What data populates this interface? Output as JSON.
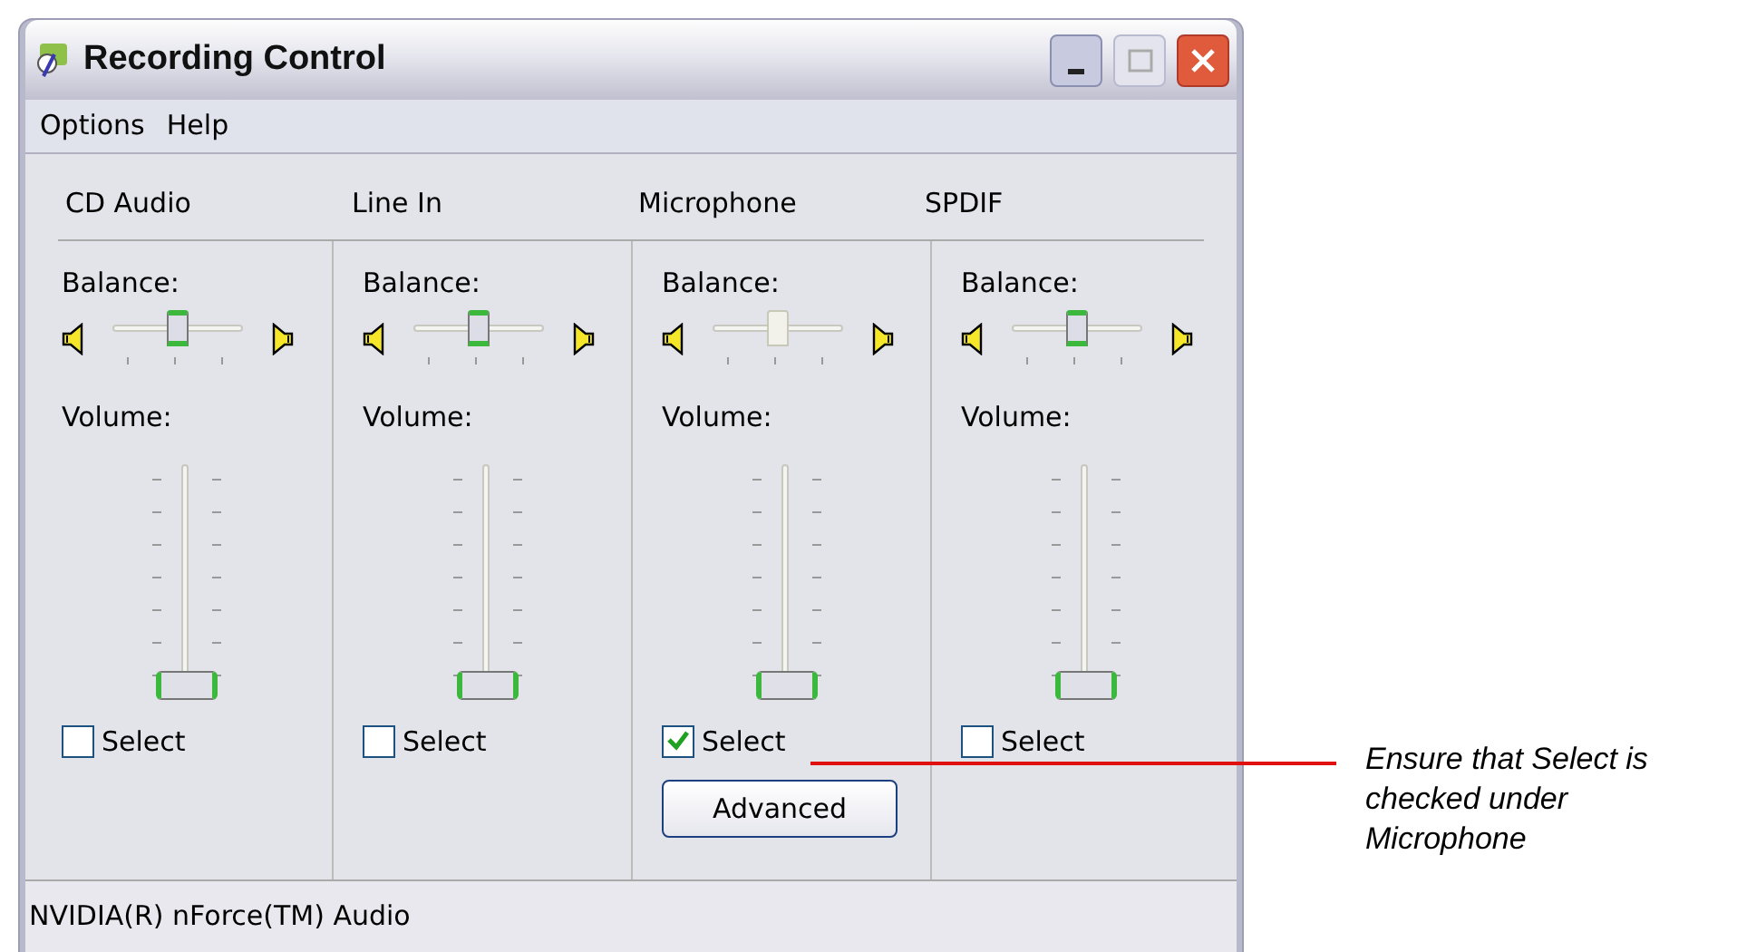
{
  "window": {
    "title": "Recording Control"
  },
  "menu": [
    "Options",
    "Help"
  ],
  "channels": [
    {
      "name": "CD Audio",
      "balance_label": "Balance:",
      "balance": {
        "level": 0.5,
        "focused": false
      },
      "volume_label": "Volume:",
      "volume": {
        "level": 0
      },
      "select": {
        "label": "Select",
        "checked": false
      }
    },
    {
      "name": "Line In",
      "balance_label": "Balance:",
      "balance": {
        "level": 0.5,
        "focused": false
      },
      "volume_label": "Volume:",
      "volume": {
        "level": 0
      },
      "select": {
        "label": "Select",
        "checked": false
      }
    },
    {
      "name": "Microphone",
      "balance_label": "Balance:",
      "balance": {
        "level": 0.5,
        "focused": true
      },
      "volume_label": "Volume:",
      "volume": {
        "level": 0
      },
      "select": {
        "label": "Select",
        "checked": true
      },
      "button": "Advanced"
    },
    {
      "name": "SPDIF",
      "balance_label": "Balance:",
      "balance": {
        "level": 0.5,
        "focused": false
      },
      "volume_label": "Volume:",
      "volume": {
        "level": 0
      },
      "select": {
        "label": "Select",
        "checked": false
      }
    }
  ],
  "status_bar": "NVIDIA(R) nForce(TM) Audio",
  "annotation": "Ensure that Select is checked under Microphone"
}
